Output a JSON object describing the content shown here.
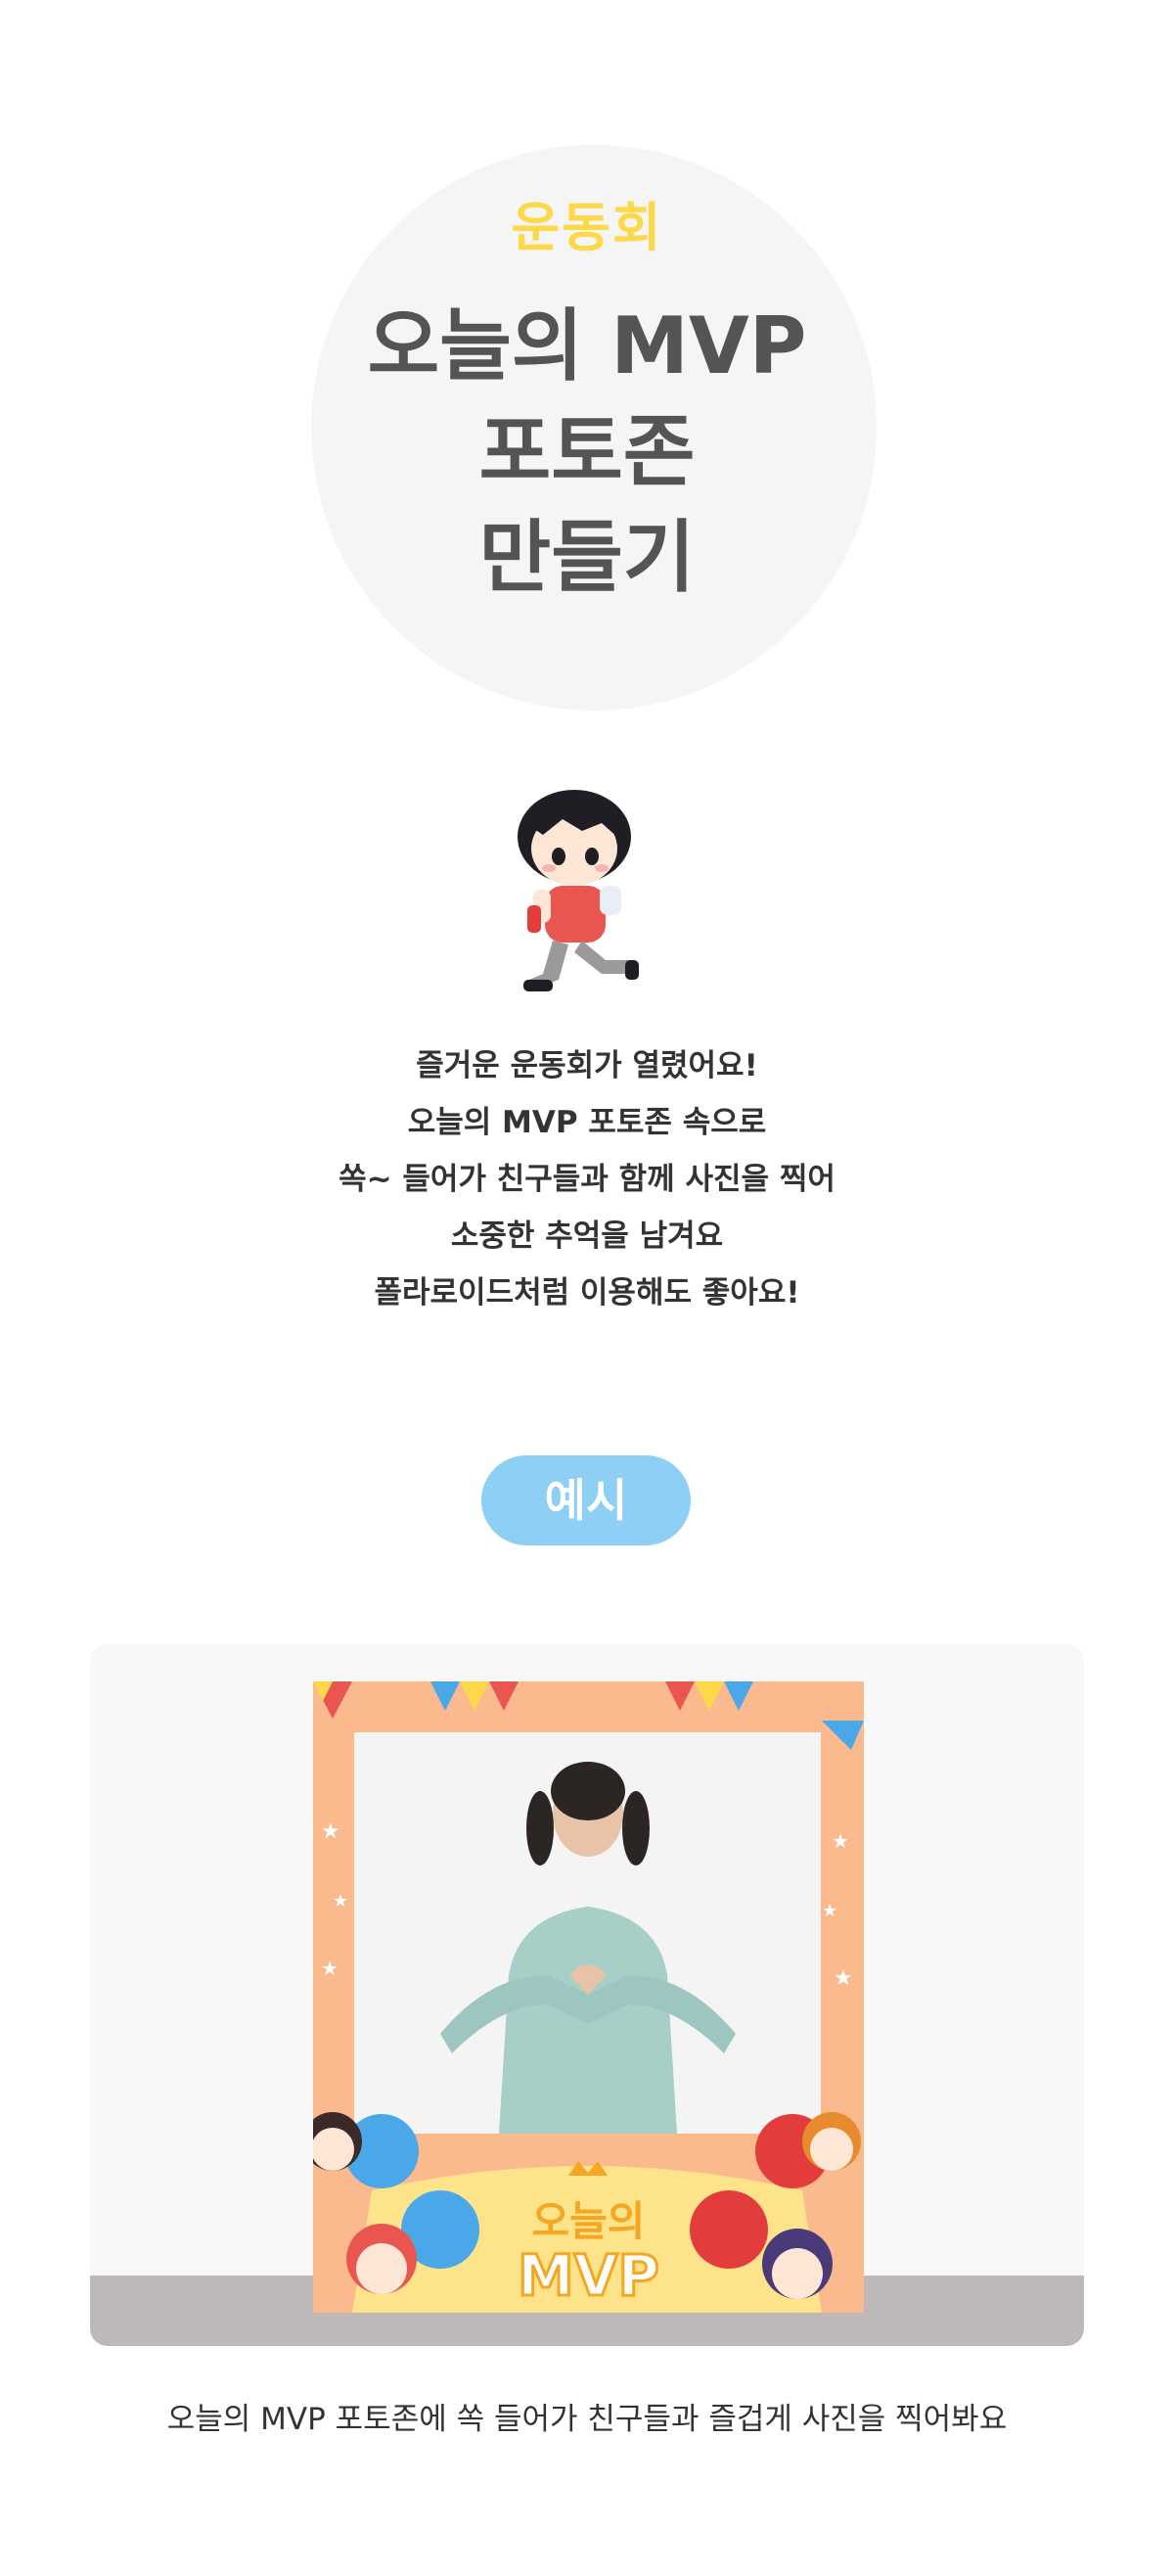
{
  "hero": {
    "subtitle": "운동회",
    "title_lines": [
      "오늘의 MVP",
      "포토존",
      "만들기"
    ]
  },
  "description": {
    "lines": [
      "즐거운 운동회가 열렸어요!",
      "오늘의 MVP 포토존 속으로",
      "쏙~ 들어가 친구들과 함께 사진을 찍어",
      "소중한 추억을 남겨요",
      "폴라로이드처럼 이용해도 좋아요!"
    ]
  },
  "example": {
    "badge_label": "예시",
    "frame_badge_top": "오늘의",
    "frame_badge_bottom": "MVP",
    "caption": "오늘의 MVP 포토존에 쏙 들어가 친구들과 즐겁게 사진을 찍어봐요"
  },
  "colors": {
    "accent_yellow": "#fdd94a",
    "title_gray": "#545454",
    "badge_blue": "#8ecff5",
    "frame_orange": "#fbb98e"
  }
}
